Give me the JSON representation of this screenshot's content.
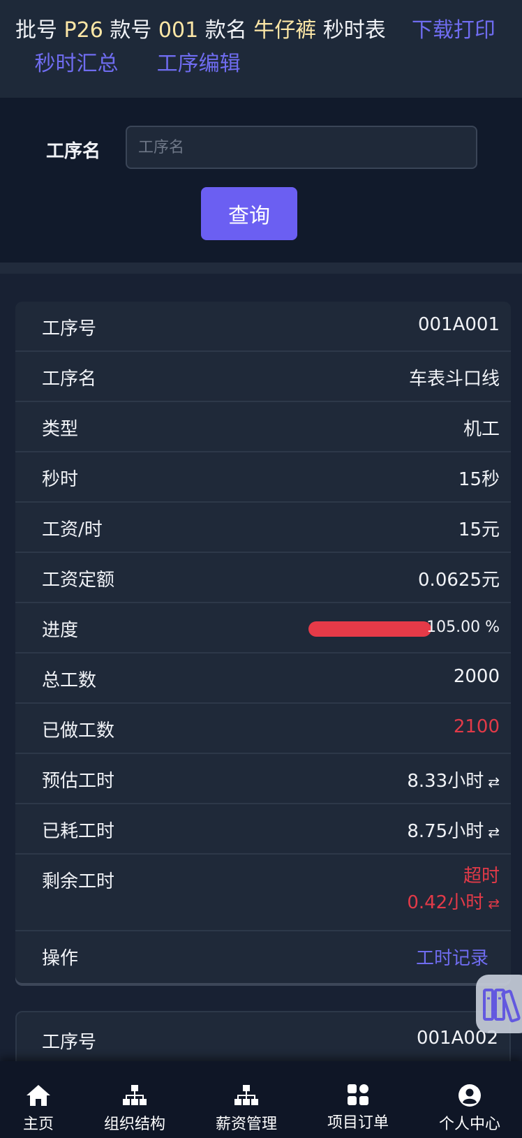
{
  "header": {
    "batch_label": "批号",
    "batch_value": "P26",
    "style_no_label": "款号",
    "style_no_value": "001",
    "style_name_label": "款名",
    "style_name_value": "牛仔裤",
    "sheet_label": "秒时表",
    "download_print": "下载打印",
    "seconds_summary": "秒时汇总",
    "process_edit": "工序编辑"
  },
  "search": {
    "label": "工序名",
    "placeholder": "工序名",
    "button": "查询"
  },
  "card": {
    "process_no_label": "工序号",
    "process_no": "001A001",
    "process_name_label": "工序名",
    "process_name": "车表斗口线",
    "type_label": "类型",
    "type": "机工",
    "seconds_label": "秒时",
    "seconds": "15秒",
    "wage_hour_label": "工资/时",
    "wage_hour": "15元",
    "wage_quota_label": "工资定额",
    "wage_quota": "0.0625元",
    "progress_label": "进度",
    "progress_text": "105.00 %",
    "progress_fraction": 1.05,
    "total_label": "总工数",
    "total": "2000",
    "done_label": "已做工数",
    "done": "2100",
    "estimated_label": "预估工时",
    "estimated": "8.33小时",
    "consumed_label": "已耗工时",
    "consumed": "8.75小时",
    "remaining_label": "剩余工时",
    "remaining_status": "超时",
    "remaining": "0.42小时",
    "action_label": "操作",
    "action_link": "工时记录"
  },
  "card2": {
    "process_no_label": "工序号",
    "process_no": "001A002"
  },
  "fab": {
    "icon": "books-icon"
  },
  "tabs": [
    {
      "label": "主页",
      "icon": "home-icon"
    },
    {
      "label": "组织结构",
      "icon": "org-chart-icon"
    },
    {
      "label": "薪资管理",
      "icon": "org-chart-icon"
    },
    {
      "label": "项目订单",
      "icon": "grid-icon"
    },
    {
      "label": "个人中心",
      "icon": "user-circle-icon"
    }
  ],
  "colors": {
    "accent": "#6b5ff2",
    "danger": "#e23a48",
    "highlight": "#fde7a6"
  }
}
